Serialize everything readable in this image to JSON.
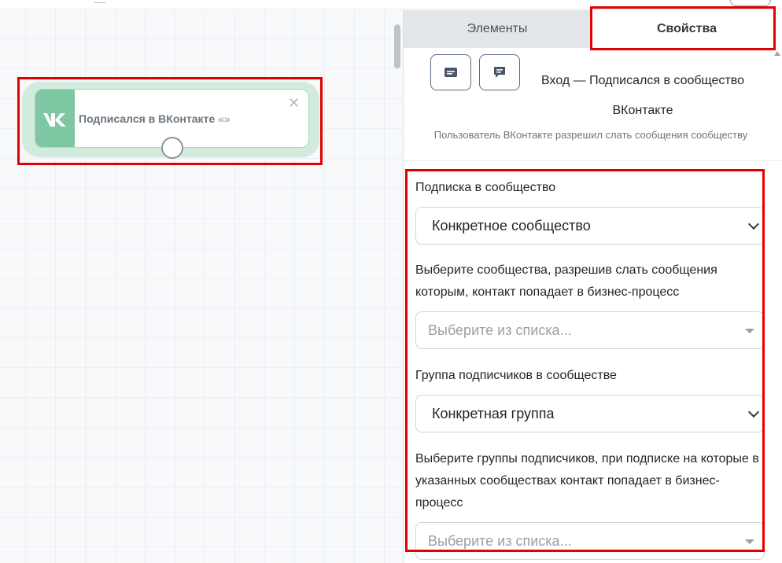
{
  "canvas": {
    "node": {
      "title": "Подписался в ВКонтакте",
      "quote": "«»",
      "close": "✕"
    }
  },
  "panel": {
    "tabs": [
      {
        "label": "Элементы",
        "active": false
      },
      {
        "label": "Свойства",
        "active": true
      }
    ],
    "header": {
      "title_line1": "Вход — Подписался в сообщество",
      "title_line2": "ВКонтакте",
      "description": "Пользователь ВКонтакте разрешил слать сообщения сообществу"
    },
    "form": {
      "subscription_label": "Подписка в сообщество",
      "subscription_value": "Конкретное сообщество",
      "communities_label": "Выберите сообщества, разрешив слать сообщения которым, контакт попадает в бизнес-процесс",
      "communities_placeholder": "Выберите из списка...",
      "group_label": "Группа подписчиков в сообществе",
      "group_value": "Конкретная группа",
      "groups_label": "Выберите группы подписчиков, при подписке на которые в указанных сообществах контакт попадает в бизнес-процесс",
      "groups_placeholder": "Выберите из списка..."
    }
  },
  "colors": {
    "highlight": "#e30000",
    "vk_green": "#7fc7a2",
    "node_bg": "#d3ebdd"
  }
}
